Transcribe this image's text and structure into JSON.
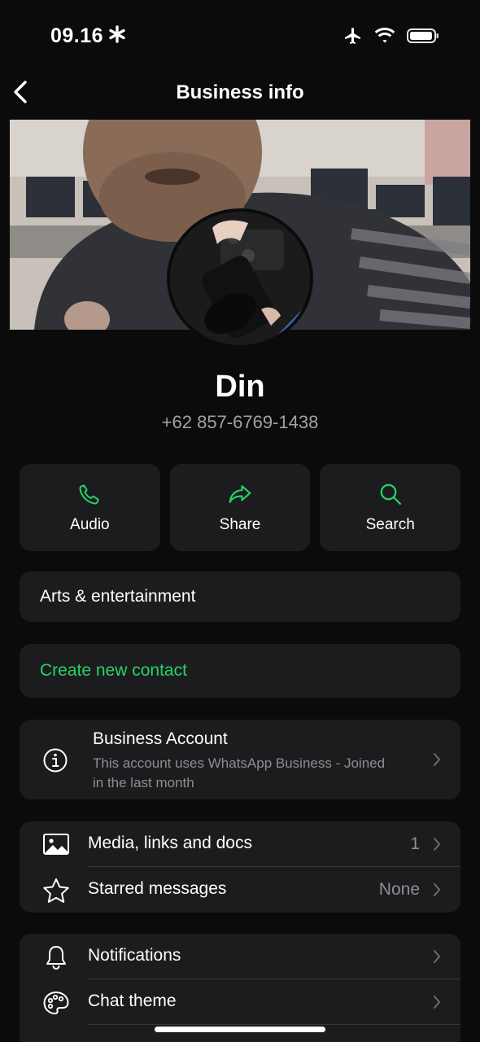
{
  "status_bar": {
    "time": "09.16"
  },
  "header": {
    "title": "Business info"
  },
  "profile": {
    "name": "Din",
    "phone": "+62 857-6769-1438"
  },
  "actions": [
    {
      "label": "Audio",
      "icon": "phone-icon"
    },
    {
      "label": "Share",
      "icon": "share-icon"
    },
    {
      "label": "Search",
      "icon": "search-icon"
    }
  ],
  "category": "Arts & entertainment",
  "create_contact": "Create new contact",
  "business_account": {
    "title": "Business Account",
    "description": "This account uses WhatsApp Business - Joined in the last month"
  },
  "media_section": [
    {
      "label": "Media, links and docs",
      "value": "1",
      "icon": "image-icon"
    },
    {
      "label": "Starred messages",
      "value": "None",
      "icon": "star-icon"
    }
  ],
  "settings_section": [
    {
      "label": "Notifications",
      "icon": "bell-icon"
    },
    {
      "label": "Chat theme",
      "icon": "palette-icon"
    }
  ],
  "colors": {
    "accent": "#25d366",
    "card": "#1c1c1e",
    "background": "#0b0b0b"
  }
}
